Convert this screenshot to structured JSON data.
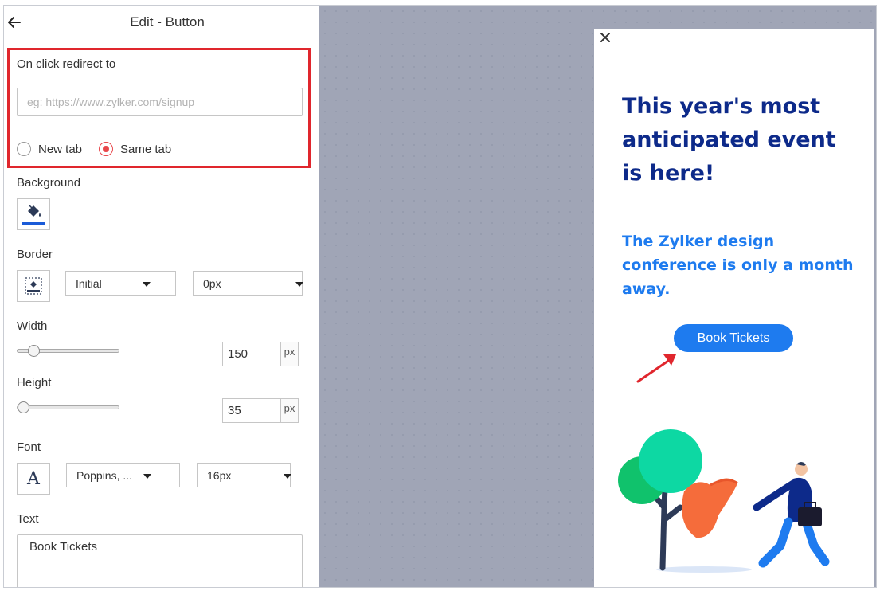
{
  "header": {
    "title": "Edit - Button"
  },
  "redirect": {
    "label": "On click redirect to",
    "placeholder": "eg: https://www.zylker.com/signup",
    "options": [
      {
        "label": "New tab",
        "checked": false
      },
      {
        "label": "Same tab",
        "checked": true
      }
    ]
  },
  "background": {
    "label": "Background"
  },
  "border": {
    "label": "Border",
    "style_value": "Initial",
    "width_value": "0px"
  },
  "width": {
    "label": "Width",
    "value": "150",
    "unit": "px",
    "slider_fraction": 0.17
  },
  "height": {
    "label": "Height",
    "value": "35",
    "unit": "px",
    "slider_fraction": 0.04
  },
  "font": {
    "label": "Font",
    "icon_glyph": "A",
    "family_value": "Poppins, ...",
    "size_value": "16px"
  },
  "text": {
    "label": "Text",
    "value": "Book Tickets"
  },
  "preview": {
    "headline": "This year's most anticipated event is here!",
    "subhead": "The Zylker design conference is only a month away.",
    "button_label": "Book Tickets"
  },
  "colors": {
    "highlight": "#e0262d",
    "accent_red": "#e8474b",
    "headline": "#0d2a8a",
    "brand_blue": "#1e7bef",
    "canvas": "#a0a5b6"
  }
}
